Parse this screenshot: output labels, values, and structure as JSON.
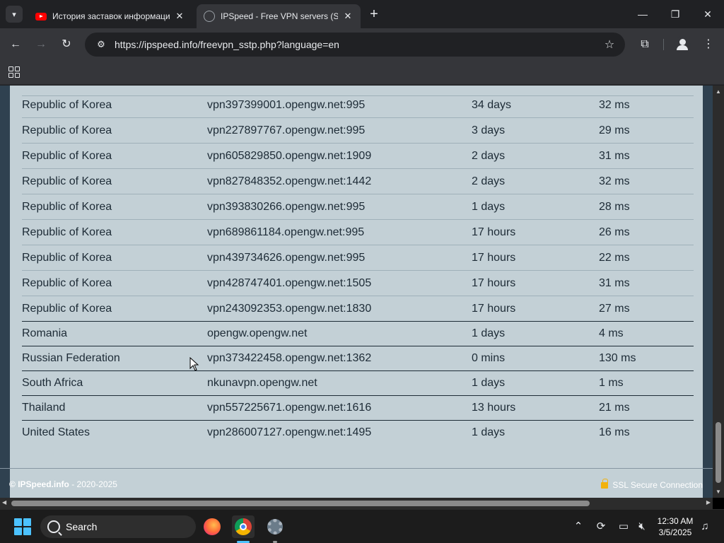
{
  "browser": {
    "tabs": [
      {
        "title": "История заставок информаци",
        "active": false,
        "icon": "youtube-icon"
      },
      {
        "title": "IPSpeed - Free VPN servers (SS",
        "active": true,
        "icon": "globe-icon"
      }
    ],
    "new_tab": "+",
    "window_controls": {
      "minimize": "—",
      "maximize": "❐",
      "close": "✕"
    },
    "nav": {
      "back": "←",
      "forward": "→",
      "reload": "↻"
    },
    "url": "https://ipspeed.info/freevpn_sstp.php?language=en",
    "star": "☆",
    "extensions": "⧉",
    "menu": "⋮"
  },
  "servers": [
    {
      "country": "Republic of Korea",
      "host": "vpn397399001.opengw.net:995",
      "uptime": "34 days",
      "ping": "32 ms"
    },
    {
      "country": "Republic of Korea",
      "host": "vpn227897767.opengw.net:995",
      "uptime": "3 days",
      "ping": "29 ms"
    },
    {
      "country": "Republic of Korea",
      "host": "vpn605829850.opengw.net:1909",
      "uptime": "2 days",
      "ping": "31 ms"
    },
    {
      "country": "Republic of Korea",
      "host": "vpn827848352.opengw.net:1442",
      "uptime": "2 days",
      "ping": "32 ms"
    },
    {
      "country": "Republic of Korea",
      "host": "vpn393830266.opengw.net:995",
      "uptime": "1 days",
      "ping": "28 ms"
    },
    {
      "country": "Republic of Korea",
      "host": "vpn689861184.opengw.net:995",
      "uptime": "17 hours",
      "ping": "26 ms"
    },
    {
      "country": "Republic of Korea",
      "host": "vpn439734626.opengw.net:995",
      "uptime": "17 hours",
      "ping": "22 ms"
    },
    {
      "country": "Republic of Korea",
      "host": "vpn428747401.opengw.net:1505",
      "uptime": "17 hours",
      "ping": "31 ms"
    },
    {
      "country": "Republic of Korea",
      "host": "vpn243092353.opengw.net:1830",
      "uptime": "17 hours",
      "ping": "27 ms"
    },
    {
      "country": "Romania",
      "host": "opengw.opengw.net",
      "uptime": "1 days",
      "ping": "4 ms"
    },
    {
      "country": "Russian Federation",
      "host": "vpn373422458.opengw.net:1362",
      "uptime": "0 mins",
      "ping": "130 ms"
    },
    {
      "country": "South Africa",
      "host": "nkunavpn.opengw.net",
      "uptime": "1 days",
      "ping": "1 ms"
    },
    {
      "country": "Thailand",
      "host": "vpn557225671.opengw.net:1616",
      "uptime": "13 hours",
      "ping": "21 ms"
    },
    {
      "country": "United States",
      "host": "vpn286007127.opengw.net:1495",
      "uptime": "1 days",
      "ping": "16 ms"
    }
  ],
  "footer": {
    "copyright_symbol": "©",
    "site": "IPSpeed.info",
    "years": " - 2020-2025",
    "ssl": "SSL Secure Connection"
  },
  "taskbar": {
    "search_label": "Search",
    "time": "12:30 AM",
    "date": "3/5/2025"
  },
  "colors": {
    "table_bg": "#c3d0d6",
    "page_bg": "#2f4150",
    "lock": "#f2b20d",
    "taskbar_accent": "#4cc2ff"
  }
}
